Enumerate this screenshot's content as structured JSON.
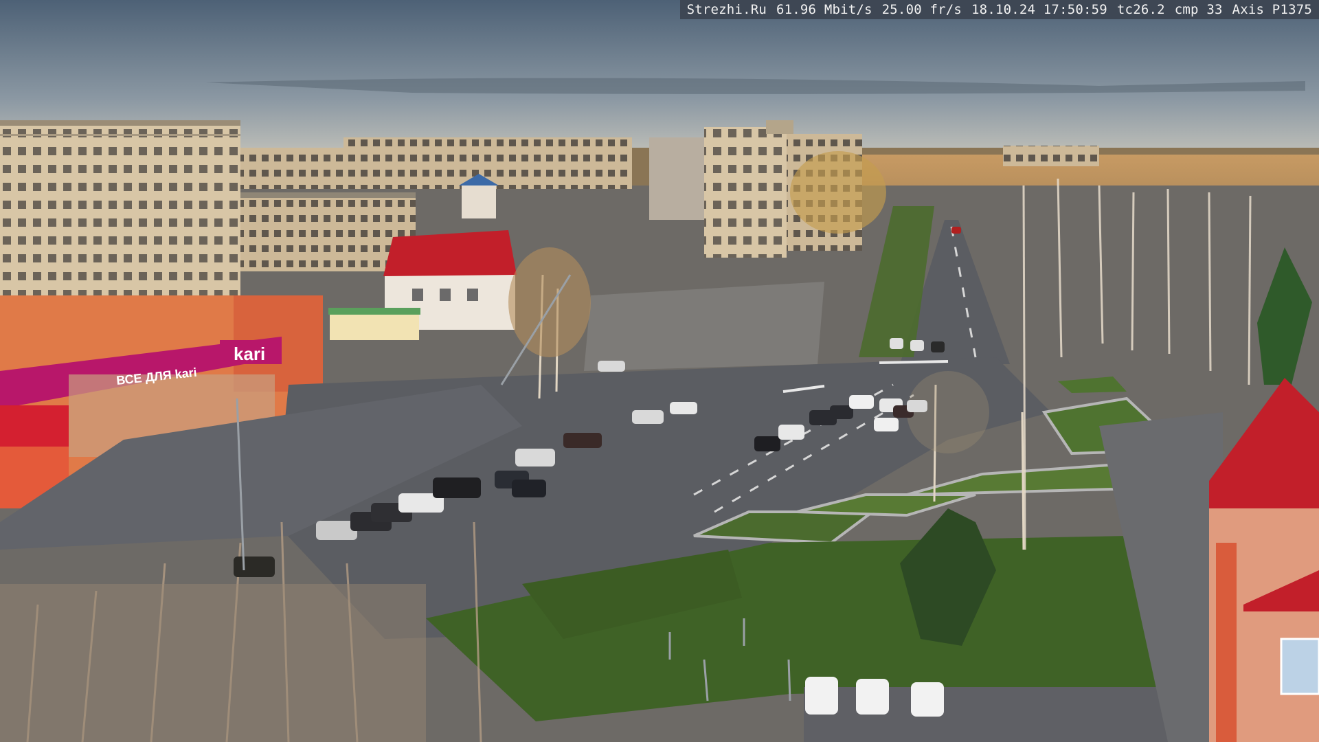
{
  "overlay": {
    "site": "Strezhi.Ru",
    "bitrate": "61.96 Mbit/s",
    "framerate": "25.00 fr/s",
    "datetime": "18.10.24 17:50:59",
    "tc": "tc26.2",
    "cmp": "cmp 33",
    "camera": "Axis P1375"
  },
  "storefront": {
    "sign_main": "kari",
    "sign_secondary": "ВСЕ ДЛЯ kari"
  },
  "colors": {
    "sky_top": "#4d6176",
    "sky_horizon": "#c9c7bd",
    "road": "#5b5d62",
    "grass": "#4b6b2e",
    "brand": "#b8176a",
    "roof_red": "#c21f2a"
  }
}
